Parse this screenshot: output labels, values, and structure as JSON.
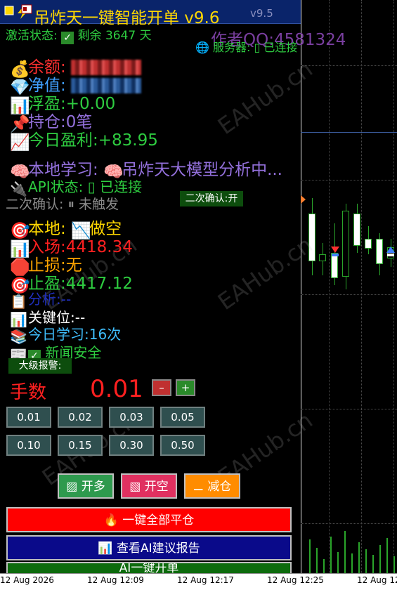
{
  "title": {
    "main": "吊炸天一键智能开单 v9.6",
    "ghost": "v9.5",
    "author": "作者QQ:4581324"
  },
  "activation": {
    "label": "激活状态:",
    "check": "✓",
    "remaining": "剩余",
    "days": "3647",
    "unit": "天"
  },
  "server": {
    "label": "服务器:",
    "status": "已连接"
  },
  "account": {
    "balance_label": "余额:",
    "equity_label": "净值:",
    "float_label": "浮盈:",
    "float_value": "+0.00",
    "position_label": "持仓:",
    "position_value": "0笔",
    "today_label": "今日盈利:",
    "today_value": "+83.95"
  },
  "learning": {
    "label": "本地学习:",
    "status": "吊炸天大模型分析中..."
  },
  "api": {
    "label": "API状态:",
    "status": "已连接"
  },
  "confirm": {
    "label": "二次确认:",
    "status": "未触发",
    "toggle": "二次确认:开"
  },
  "signal": {
    "local_label": "本地:",
    "local_value": "做空",
    "entry_label": "入场:",
    "entry_value": "4418.34",
    "sl_label": "止损:",
    "sl_value": "无",
    "tp_label": "止盈:",
    "tp_value": "4417.12",
    "analysis_label": "分析:",
    "analysis_value": "--",
    "key_label": "关键位:",
    "key_value": "--",
    "study_label": "今日学习:",
    "study_value": "16次",
    "news_check": "✓",
    "news_label": "新闻安全",
    "alert_label": "大级报警:"
  },
  "lots": {
    "label": "手数",
    "value": "0.01",
    "minus": "–",
    "plus": "+",
    "presets": [
      "0.01",
      "0.02",
      "0.03",
      "0.05",
      "0.10",
      "0.15",
      "0.30",
      "0.50"
    ]
  },
  "actions": {
    "buy": "开多",
    "sell": "开空",
    "reduce": "减仓"
  },
  "wide_buttons": {
    "close_all": "一键全部平仓",
    "ai_report": "查看AI建议报告",
    "ai_open": "AI一键开单"
  },
  "time_axis": [
    "12 Aug 2026",
    "12 Aug 12:09",
    "12 Aug 12:17",
    "12 Aug 12:25",
    "12 Aug 12:"
  ],
  "watermark": "EAHub.cn",
  "colors": {
    "gold": "#ffd700",
    "green": "#2ecc40",
    "red": "#ff2020",
    "violet": "#9370db",
    "cyan": "#40c0ff"
  }
}
